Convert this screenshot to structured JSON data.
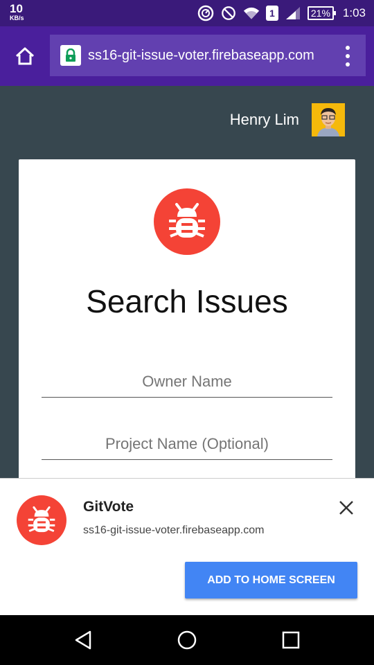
{
  "status_bar": {
    "speed_value": "10",
    "speed_unit": "KB/s",
    "sim_slot": "1",
    "battery": "21%",
    "time": "1:03"
  },
  "browser": {
    "url": "ss16-git-issue-voter.firebaseapp.com",
    "icons": [
      "home-icon",
      "lock-icon",
      "overflow-menu-icon"
    ]
  },
  "user": {
    "name": "Henry Lim"
  },
  "card": {
    "title": "Search Issues",
    "owner_placeholder": "Owner Name",
    "project_placeholder": "Project Name (Optional)"
  },
  "install_banner": {
    "app_name": "GitVote",
    "url": "ss16-git-issue-voter.firebaseapp.com",
    "button_label": "ADD TO HOME SCREEN"
  },
  "colors": {
    "status_bar": "#3a1a7a",
    "toolbar": "#4a1f9c",
    "page_bg": "#37474f",
    "logo_red": "#f44336",
    "button_blue": "#4285f4"
  }
}
